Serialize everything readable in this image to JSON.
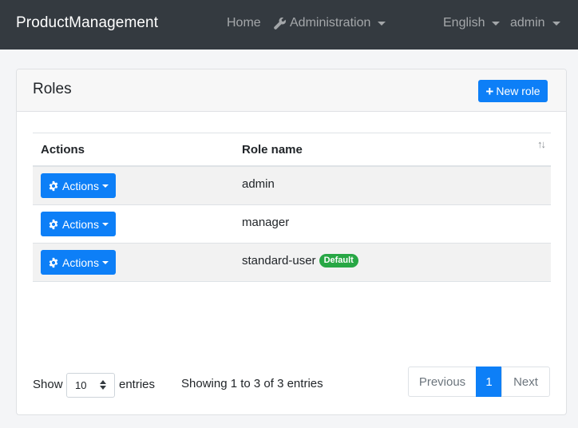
{
  "navbar": {
    "brand": "ProductManagement",
    "home": "Home",
    "administration": "Administration",
    "language": "English",
    "user": "admin"
  },
  "card": {
    "title": "Roles",
    "new_role_label": "New role"
  },
  "table": {
    "headers": {
      "actions": "Actions",
      "role_name": "Role name"
    },
    "rows": [
      {
        "actions_label": "Actions",
        "role": "admin",
        "badge": ""
      },
      {
        "actions_label": "Actions",
        "role": "manager",
        "badge": ""
      },
      {
        "actions_label": "Actions",
        "role": "standard-user",
        "badge": "Default"
      }
    ]
  },
  "footer": {
    "show_label": "Show",
    "page_size": "10",
    "entries_label": "entries",
    "info": "Showing 1 to 3 of 3 entries",
    "previous": "Previous",
    "current_page": "1",
    "next": "Next"
  },
  "colors": {
    "navbar_bg": "#343a40",
    "primary": "#0d7ff7",
    "badge_success": "#28a745"
  }
}
